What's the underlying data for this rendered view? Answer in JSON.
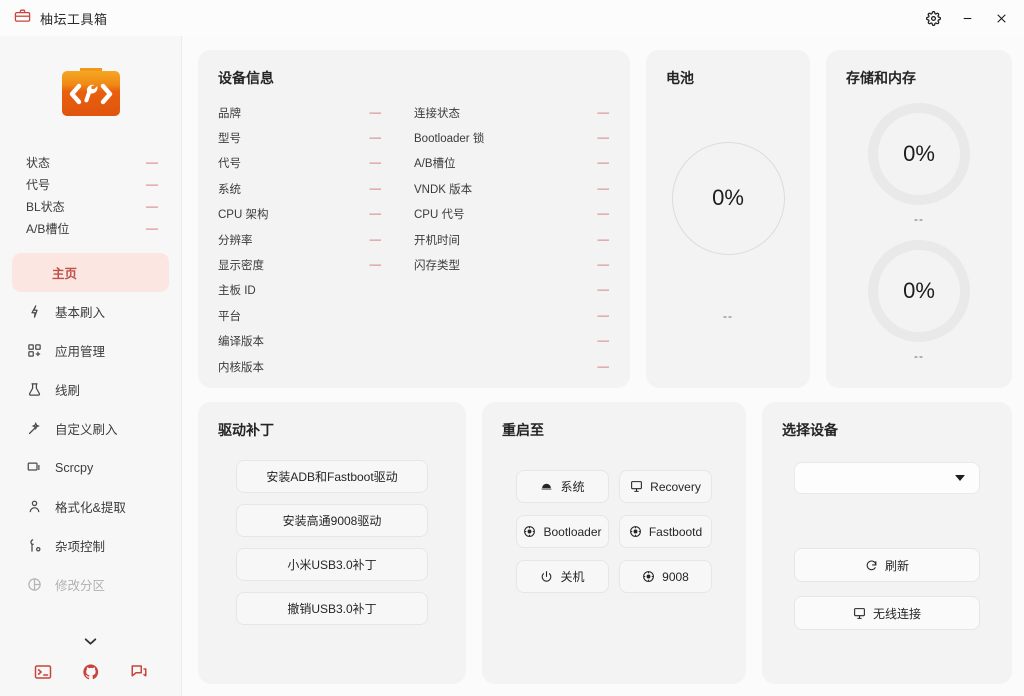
{
  "window": {
    "title": "柚坛工具箱",
    "app_icon": "toolbox-icon",
    "controls": {
      "settings": "gear-icon",
      "minimize": "minimize-icon",
      "close": "close-icon"
    }
  },
  "colors": {
    "accent_red": "#cf6a6a",
    "active_bg": "#fbe6e1",
    "active_text": "#c0504a",
    "card_bg": "#f3f3f3",
    "page_bg": "#fbfbfb",
    "logo_orange": "#e8600f",
    "footer_icon": "#c8443a"
  },
  "sidebar": {
    "logo_icon": "toolbox-code-logo",
    "status": [
      {
        "label": "状态",
        "value": "—"
      },
      {
        "label": "代号",
        "value": "—"
      },
      {
        "label": "BL状态",
        "value": "—"
      },
      {
        "label": "A/B槽位",
        "value": "—"
      }
    ],
    "nav": [
      {
        "label": "主页",
        "icon": "home-icon",
        "active": true
      },
      {
        "label": "基本刷入",
        "icon": "flash-icon",
        "active": false
      },
      {
        "label": "应用管理",
        "icon": "apps-grid-icon",
        "active": false
      },
      {
        "label": "线刷",
        "icon": "flask-icon",
        "active": false
      },
      {
        "label": "自定义刷入",
        "icon": "magic-wand-icon",
        "active": false
      },
      {
        "label": "Scrcpy",
        "icon": "laptop-icon",
        "active": false
      },
      {
        "label": "格式化&提取",
        "icon": "person-icon",
        "active": false
      },
      {
        "label": "杂项控制",
        "icon": "tools-icon",
        "active": false
      },
      {
        "label": "修改分区",
        "icon": "partition-icon",
        "active": false,
        "faded": true
      }
    ],
    "more_chevron": "chevron-down-icon",
    "footer_icons": [
      {
        "name": "terminal-icon"
      },
      {
        "name": "github-icon"
      },
      {
        "name": "forum-icon"
      }
    ]
  },
  "device_info": {
    "title": "设备信息",
    "left_column": [
      {
        "label": "品牌",
        "value": "—"
      },
      {
        "label": "型号",
        "value": "—"
      },
      {
        "label": "代号",
        "value": "—"
      },
      {
        "label": "系统",
        "value": "—"
      },
      {
        "label": "CPU 架构",
        "value": "—"
      },
      {
        "label": "分辨率",
        "value": "—"
      },
      {
        "label": "显示密度",
        "value": "—"
      },
      {
        "label": "主板 ID",
        "value": ""
      },
      {
        "label": "平台",
        "value": ""
      },
      {
        "label": "编译版本",
        "value": ""
      },
      {
        "label": "内核版本",
        "value": ""
      }
    ],
    "right_column": [
      {
        "label": "连接状态",
        "value": "—"
      },
      {
        "label": "Bootloader 锁",
        "value": "—"
      },
      {
        "label": "A/B槽位",
        "value": "—"
      },
      {
        "label": "VNDK 版本",
        "value": "—"
      },
      {
        "label": "CPU 代号",
        "value": "—"
      },
      {
        "label": "开机时间",
        "value": "—"
      },
      {
        "label": "闪存类型",
        "value": "—"
      },
      {
        "label": "",
        "value": "—"
      },
      {
        "label": "",
        "value": "—"
      },
      {
        "label": "",
        "value": "—"
      },
      {
        "label": "",
        "value": "—"
      }
    ]
  },
  "battery": {
    "title": "电池",
    "percent": "0%",
    "detail": "--"
  },
  "storage": {
    "title": "存储和内存",
    "gauges": [
      {
        "percent": "0%",
        "detail": "--"
      },
      {
        "percent": "0%",
        "detail": "--"
      }
    ]
  },
  "driver_patch": {
    "title": "驱动补丁",
    "buttons": [
      {
        "label": "安装ADB和Fastboot驱动"
      },
      {
        "label": "安装高通9008驱动"
      },
      {
        "label": "小米USB3.0补丁"
      },
      {
        "label": "撤销USB3.0补丁"
      }
    ]
  },
  "reboot": {
    "title": "重启至",
    "buttons": [
      {
        "label": "系统",
        "icon": "android-icon"
      },
      {
        "label": "Recovery",
        "icon": "monitor-icon"
      },
      {
        "label": "Bootloader",
        "icon": "target-icon"
      },
      {
        "label": "Fastbootd",
        "icon": "target-icon"
      },
      {
        "label": "关机",
        "icon": "power-icon"
      },
      {
        "label": "9008",
        "icon": "target-icon"
      }
    ]
  },
  "select_device": {
    "title": "选择设备",
    "dropdown_value": "",
    "dropdown_icon": "chevron-down-icon",
    "buttons": [
      {
        "label": "刷新",
        "icon": "refresh-icon"
      },
      {
        "label": "无线连接",
        "icon": "monitor-icon"
      }
    ]
  }
}
